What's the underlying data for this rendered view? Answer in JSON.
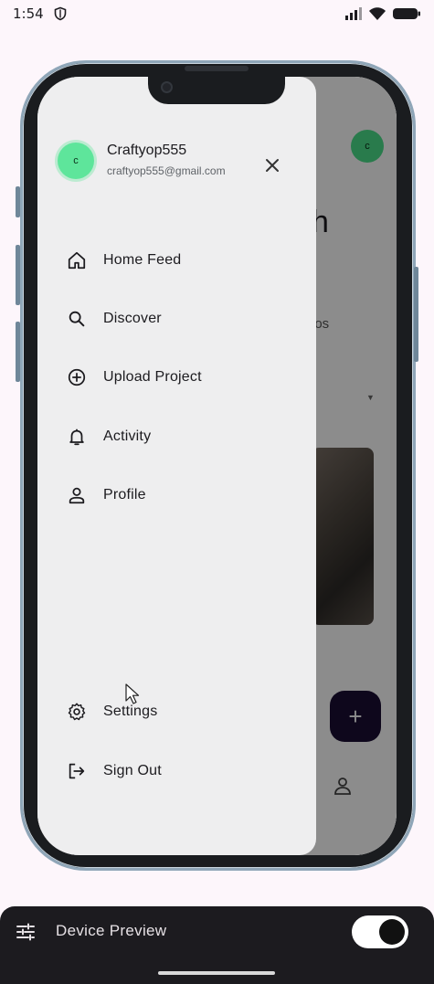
{
  "os_status": {
    "time": "1:54",
    "icons": [
      "shield-icon",
      "signal-icon",
      "wifi-icon",
      "battery-icon"
    ]
  },
  "background_app": {
    "avatar_initial": "c",
    "heading_fragment": "h",
    "subtext_fragment": "los",
    "fab_label": "+"
  },
  "drawer": {
    "user": {
      "initial": "c",
      "name": "Craftyop555",
      "email": "craftyop555@gmail.com"
    },
    "items": [
      {
        "label": "Home Feed",
        "icon": "home-icon"
      },
      {
        "label": "Discover",
        "icon": "search-icon"
      },
      {
        "label": "Upload Project",
        "icon": "add-circle-icon"
      },
      {
        "label": "Activity",
        "icon": "bell-icon"
      },
      {
        "label": "Profile",
        "icon": "person-icon"
      }
    ],
    "bottom_items": [
      {
        "label": "Settings",
        "icon": "gear-icon"
      },
      {
        "label": "Sign Out",
        "icon": "sign-out-icon"
      }
    ]
  },
  "device_preview": {
    "title": "Device Preview",
    "enabled": true
  },
  "colors": {
    "avatar": "#5ee59b",
    "fab": "#1b0d33",
    "drawer_bg": "#eeeeef",
    "frame": "#8fa6b8"
  }
}
